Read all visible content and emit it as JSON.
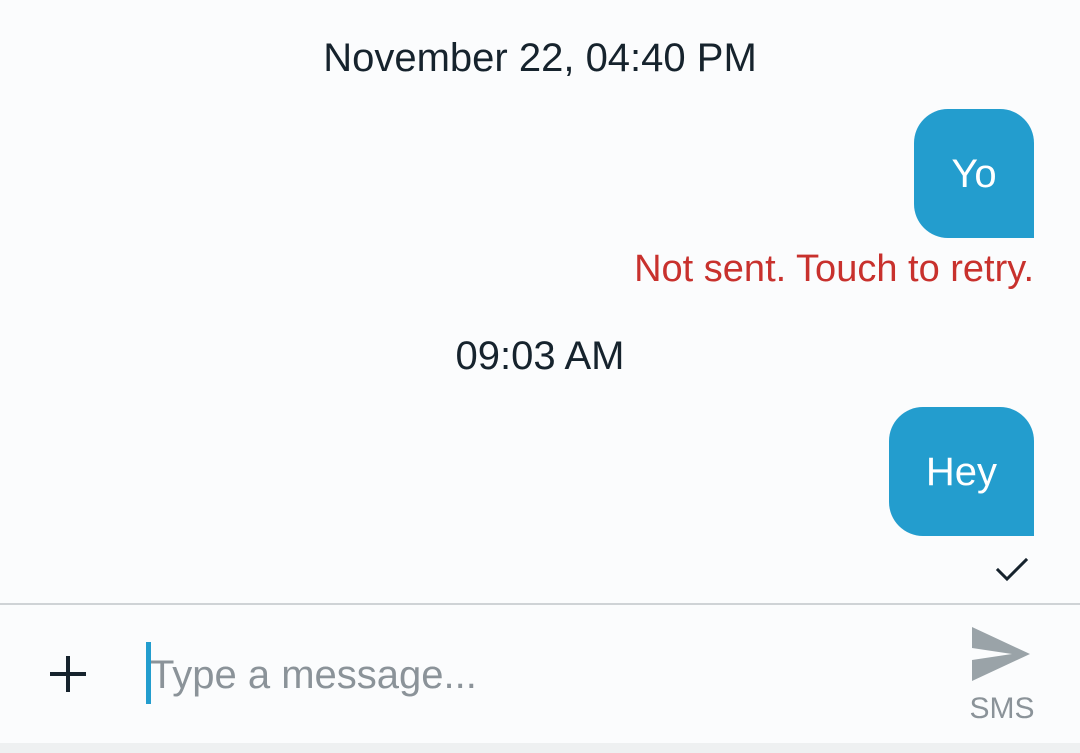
{
  "thread": {
    "timestamps": [
      "November 22, 04:40 PM",
      "09:03 AM"
    ],
    "messages": [
      {
        "text": "Yo",
        "status": "Not sent. Touch to retry."
      },
      {
        "text": "Hey",
        "status_icon": "checkmark-icon"
      }
    ]
  },
  "compose": {
    "add_icon": "plus-icon",
    "placeholder": "Type a message...",
    "value": "",
    "send_icon": "send-icon",
    "send_label": "SMS"
  },
  "colors": {
    "bubble": "#239dce",
    "error": "#c8312d",
    "text": "#16232d",
    "muted": "#8b9399"
  }
}
